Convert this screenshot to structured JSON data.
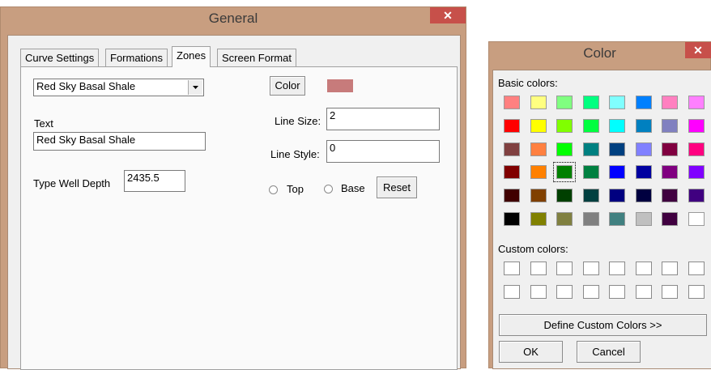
{
  "general": {
    "title": "General",
    "close_glyph": "✕",
    "tabs": [
      "Curve Settings",
      "Formations",
      "Zones",
      "Screen Format"
    ],
    "active_tab": "Zones",
    "zone_dropdown_value": "Red Sky Basal Shale",
    "text_label": "Text",
    "text_value": "Red Sky Basal Shale",
    "type_well_depth_label": "Type Well Depth",
    "type_well_depth_value": "2435.5",
    "color_button": "Color",
    "color_preview": "#c77b7b",
    "line_size_label": "Line Size:",
    "line_size_value": "2",
    "line_style_label": "Line Style:",
    "line_style_value": "0",
    "top_label": "Top",
    "base_label": "Base",
    "reset_button": "Reset"
  },
  "color_dialog": {
    "title": "Color",
    "close_glyph": "✕",
    "basic_colors_label": "Basic colors:",
    "basic_colors": [
      [
        "#ff8080",
        "#ffff80",
        "#80ff80",
        "#00ff80",
        "#80ffff",
        "#0080ff",
        "#ff80c0",
        "#ff80ff"
      ],
      [
        "#ff0000",
        "#ffff00",
        "#80ff00",
        "#00ff40",
        "#00ffff",
        "#0080c0",
        "#8080c0",
        "#ff00ff"
      ],
      [
        "#804040",
        "#ff8040",
        "#00ff00",
        "#008080",
        "#004080",
        "#8080ff",
        "#800040",
        "#ff0080"
      ],
      [
        "#800000",
        "#ff8000",
        "#008000",
        "#008040",
        "#0000ff",
        "#0000a0",
        "#800080",
        "#8000ff"
      ],
      [
        "#400000",
        "#804000",
        "#004000",
        "#004040",
        "#000080",
        "#000040",
        "#400040",
        "#400080"
      ],
      [
        "#000000",
        "#808000",
        "#808040",
        "#808080",
        "#408080",
        "#c0c0c0",
        "#400040",
        "#ffffff"
      ]
    ],
    "selected_color": "#008000",
    "custom_colors_label": "Custom colors:",
    "define_button": "Define Custom Colors >>",
    "ok_button": "OK",
    "cancel_button": "Cancel"
  }
}
